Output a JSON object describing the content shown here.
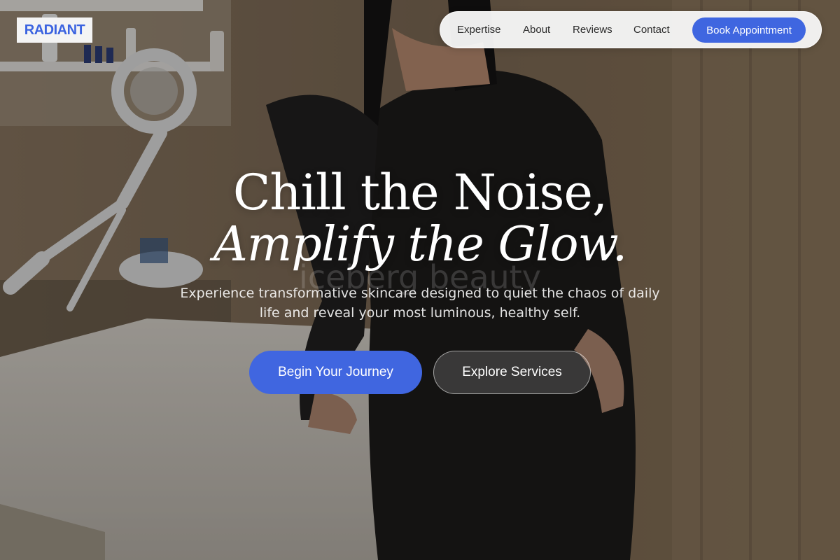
{
  "brand": {
    "logo_text": "RADIANT"
  },
  "nav": {
    "links": [
      "Expertise",
      "About",
      "Reviews",
      "Contact"
    ],
    "cta": "Book Appointment"
  },
  "hero": {
    "headline_line1": "Chill the Noise,",
    "headline_line2": "Amplify the Glow.",
    "background_watermark": "iceberg beauty",
    "subheading": "Experience transformative skincare designed to quiet the chaos of daily life and reveal your most luminous, healthy self.",
    "primary_button": "Begin Your Journey",
    "secondary_button": "Explore Services"
  },
  "colors": {
    "accent": "#3f66e0",
    "nav_background": "#f6f6f6",
    "overlay": "rgba(0,0,0,0.30)"
  }
}
